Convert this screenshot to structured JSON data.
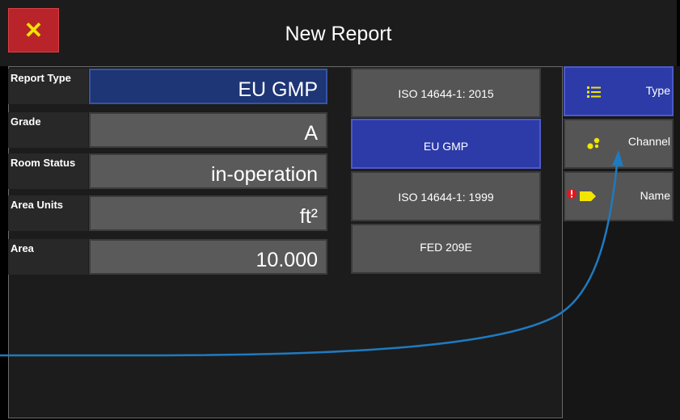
{
  "header": {
    "title": "New Report",
    "close_label": "✕"
  },
  "fields": [
    {
      "label": "Report Type",
      "value": "EU GMP",
      "selected": true
    },
    {
      "label": "Grade",
      "value": "A"
    },
    {
      "label": "Room Status",
      "value": "in-operation"
    },
    {
      "label": "Area Units",
      "value": "ft²"
    },
    {
      "label": "Area",
      "value": "10.000"
    }
  ],
  "options": [
    {
      "label": "ISO 14644-1: 2015"
    },
    {
      "label": "EU GMP",
      "active": true
    },
    {
      "label": "ISO 14644-1: 1999"
    },
    {
      "label": "FED 209E"
    }
  ],
  "tabs": [
    {
      "label": "Type",
      "icon": "list-icon",
      "active": true
    },
    {
      "label": "Channel",
      "icon": "channel-dots-icon"
    },
    {
      "label": "Name",
      "icon": "tag-icon"
    }
  ],
  "colors": {
    "accent": "#2c3ba8",
    "close": "#b9242a",
    "icon_yellow": "#f3e500",
    "alert_red": "#e8141b",
    "annotation_arrow": "#1f7ac0"
  }
}
